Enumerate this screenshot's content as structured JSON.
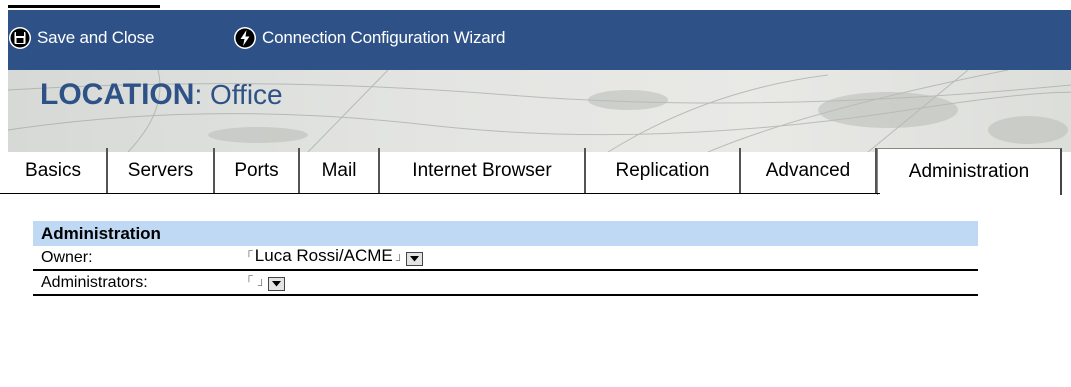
{
  "toolbar": {
    "save_close_label": "Save and Close",
    "wizard_label": "Connection Configuration Wizard",
    "background_color": "#2e5287"
  },
  "header": {
    "doc_type": "LOCATION",
    "separator": ": ",
    "doc_name": "Office"
  },
  "tabs": [
    {
      "label": "Basics",
      "active": false
    },
    {
      "label": "Servers",
      "active": false
    },
    {
      "label": "Ports",
      "active": false
    },
    {
      "label": "Mail",
      "active": false
    },
    {
      "label": "Internet Browser",
      "active": false
    },
    {
      "label": "Replication",
      "active": false
    },
    {
      "label": "Advanced",
      "active": false
    },
    {
      "label": "Administration",
      "active": true
    }
  ],
  "section": {
    "title": "Administration",
    "color": "#bfd8f3"
  },
  "fields": {
    "owner": {
      "label": "Owner:",
      "value": "Luca Rossi/ACME"
    },
    "administrators": {
      "label": "Administrators:",
      "value": ""
    }
  }
}
